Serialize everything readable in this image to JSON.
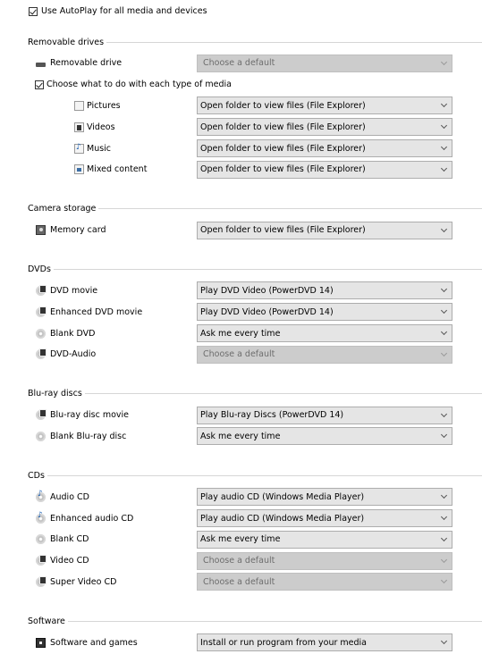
{
  "autoplay": {
    "label": "Use AutoPlay for all media and devices",
    "checked": true
  },
  "sections": [
    {
      "title": "Removable drives",
      "rows": [
        {
          "label": "Removable drive",
          "icon": "drive-icon",
          "value": "Choose a default",
          "disabled": true
        },
        {
          "type": "checkbox",
          "label": "Choose what to do with each type of media",
          "checked": true
        },
        {
          "label": "Pictures",
          "icon": "picture-file-icon",
          "value": "Open folder to view files (File Explorer)",
          "sub": true
        },
        {
          "label": "Videos",
          "icon": "video-file-icon",
          "value": "Open folder to view files (File Explorer)",
          "sub": true
        },
        {
          "label": "Music",
          "icon": "music-file-icon",
          "value": "Open folder to view files (File Explorer)",
          "sub": true
        },
        {
          "label": "Mixed content",
          "icon": "mixed-file-icon",
          "value": "Open folder to view files (File Explorer)",
          "sub": true
        }
      ]
    },
    {
      "title": "Camera storage",
      "rows": [
        {
          "label": "Memory card",
          "icon": "memory-card-icon",
          "value": "Open folder to view files (File Explorer)"
        }
      ]
    },
    {
      "title": "DVDs",
      "rows": [
        {
          "label": "DVD movie",
          "icon": "dvd-movie-icon",
          "value": "Play DVD Video (PowerDVD 14)"
        },
        {
          "label": "Enhanced DVD movie",
          "icon": "dvd-movie-icon",
          "value": "Play DVD Video (PowerDVD 14)"
        },
        {
          "label": "Blank DVD",
          "icon": "blank-disc-icon",
          "value": "Ask me every time"
        },
        {
          "label": "DVD-Audio",
          "icon": "dvd-movie-icon",
          "value": "Choose a default",
          "disabled": true
        }
      ]
    },
    {
      "title": "Blu-ray discs",
      "rows": [
        {
          "label": "Blu-ray disc movie",
          "icon": "dvd-movie-icon",
          "value": "Play Blu-ray Discs (PowerDVD 14)"
        },
        {
          "label": "Blank Blu-ray disc",
          "icon": "blank-disc-icon",
          "value": "Ask me every time"
        }
      ]
    },
    {
      "title": "CDs",
      "rows": [
        {
          "label": "Audio CD",
          "icon": "audio-cd-icon",
          "value": "Play audio CD (Windows Media Player)"
        },
        {
          "label": "Enhanced audio CD",
          "icon": "audio-cd-icon",
          "value": "Play audio CD (Windows Media Player)"
        },
        {
          "label": "Blank CD",
          "icon": "blank-disc-icon",
          "value": "Ask me every time"
        },
        {
          "label": "Video CD",
          "icon": "dvd-movie-icon",
          "value": "Choose a default",
          "disabled": true
        },
        {
          "label": "Super Video CD",
          "icon": "dvd-movie-icon",
          "value": "Choose a default",
          "disabled": true
        }
      ]
    },
    {
      "title": "Software",
      "rows": [
        {
          "label": "Software and games",
          "icon": "software-icon",
          "value": "Install or run program from your media"
        }
      ]
    }
  ]
}
